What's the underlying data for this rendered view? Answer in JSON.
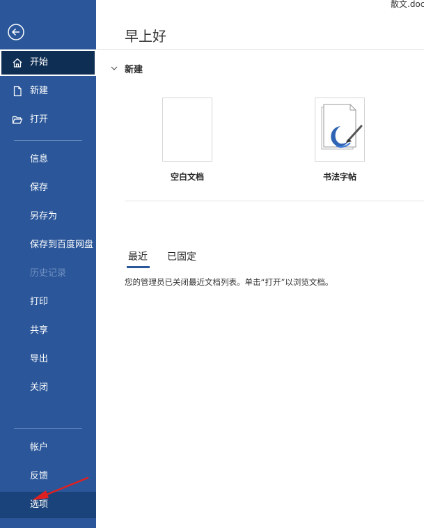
{
  "document": {
    "filename": "散文.doc"
  },
  "sidebar": {
    "items": [
      {
        "id": "home",
        "label": "开始",
        "state": "selected"
      },
      {
        "id": "new",
        "label": "新建"
      },
      {
        "id": "open",
        "label": "打开"
      },
      {
        "id": "info",
        "label": "信息"
      },
      {
        "id": "save",
        "label": "保存"
      },
      {
        "id": "save-as",
        "label": "另存为"
      },
      {
        "id": "save-baidu",
        "label": "保存到百度网盘"
      },
      {
        "id": "history",
        "label": "历史记录",
        "state": "disabled"
      },
      {
        "id": "print",
        "label": "打印"
      },
      {
        "id": "share",
        "label": "共享"
      },
      {
        "id": "export",
        "label": "导出"
      },
      {
        "id": "close",
        "label": "关闭"
      },
      {
        "id": "account",
        "label": "帐户"
      },
      {
        "id": "feedback",
        "label": "反馈"
      },
      {
        "id": "options",
        "label": "选项",
        "state": "hovered"
      }
    ]
  },
  "main": {
    "greeting": "早上好",
    "new_section": {
      "title": "新建",
      "templates": [
        {
          "label": "空白文档",
          "icon": "blank-document-icon"
        },
        {
          "label": "书法字帖",
          "icon": "calligraphy-brush-icon"
        }
      ]
    },
    "tabs": [
      {
        "label": "最近",
        "active": true
      },
      {
        "label": "已固定"
      }
    ],
    "recent_message": "您的管理员已关闭最近文档列表。单击“打开”以浏览文档。"
  },
  "colors": {
    "sidebar": "#2b579a",
    "selected_item": "#0f2e54",
    "hover_item": "#19437a",
    "annotation_arrow": "#e02020"
  }
}
